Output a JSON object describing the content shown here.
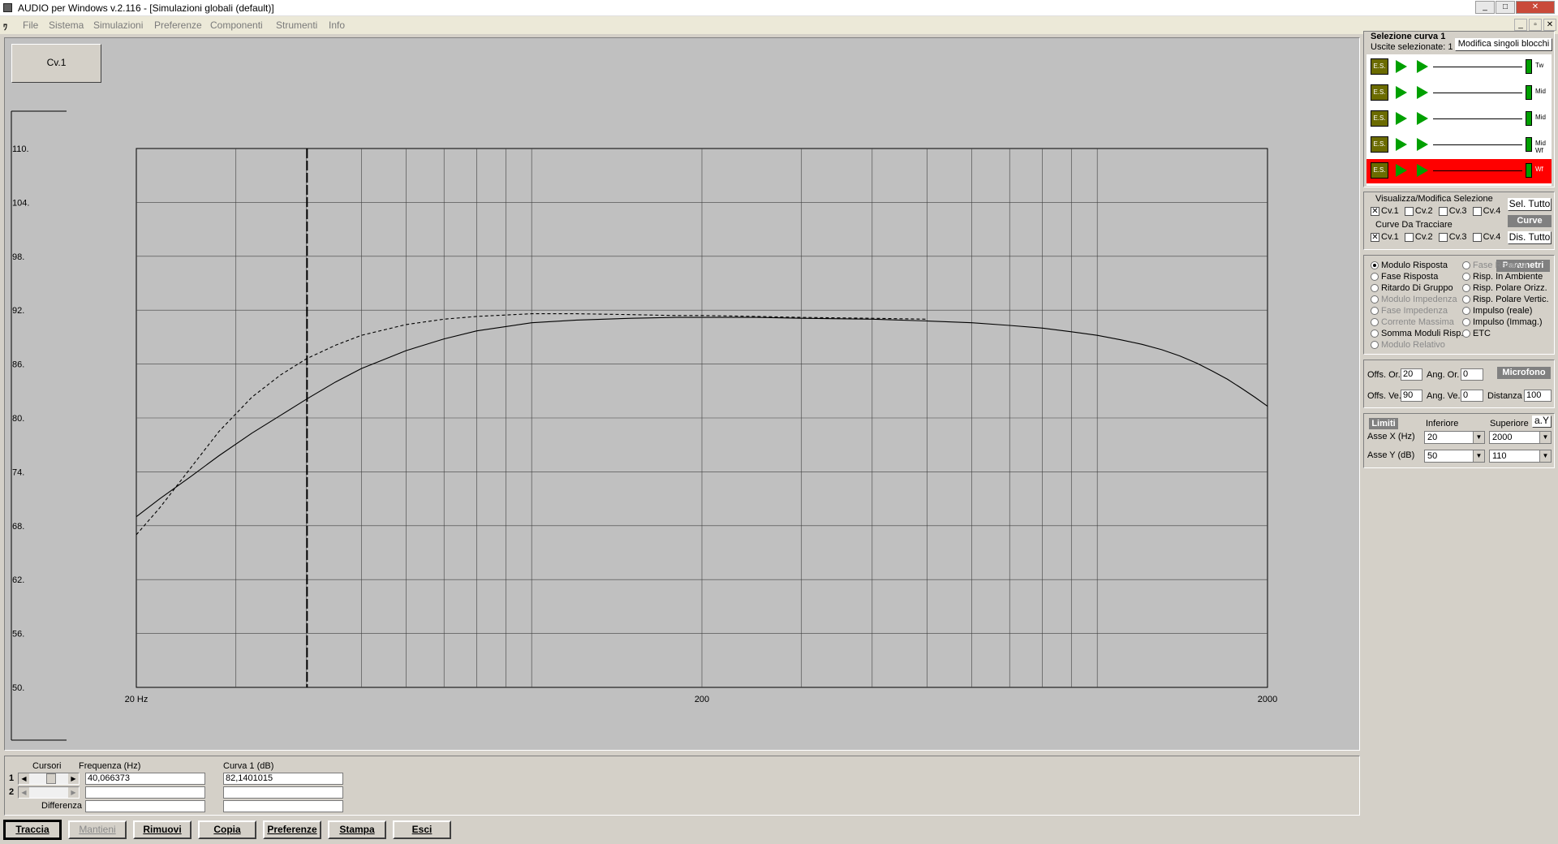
{
  "window": {
    "title": "AUDIO per Windows v.2.116 - [Simulazioni globali (default)]",
    "controls": [
      "_",
      "□",
      "✕"
    ]
  },
  "menu": {
    "items": [
      "File",
      "Sistema",
      "Simulazioni",
      "Preferenze",
      "Componenti",
      "Strumenti",
      "Info"
    ],
    "mdi_controls": [
      "_",
      "▫",
      "✕"
    ]
  },
  "curve_tab": {
    "label": "Cv.1"
  },
  "chart_data": {
    "type": "line",
    "x_scale": "log",
    "xlim": [
      20,
      2000
    ],
    "ylim": [
      50,
      110
    ],
    "y_ticks": [
      "110.",
      "104.",
      "98.",
      "92.",
      "86.",
      "80.",
      "74.",
      "68.",
      "62.",
      "56.",
      "50."
    ],
    "y_tick_values": [
      110,
      104,
      98,
      92,
      86,
      80,
      74,
      68,
      62,
      56,
      50
    ],
    "x_tick_labels": [
      {
        "value": 20,
        "label": "20 Hz"
      },
      {
        "value": 200,
        "label": "200"
      },
      {
        "value": 2000,
        "label": "2000"
      }
    ],
    "grid": true,
    "cursor_x": 40.066373,
    "series": [
      {
        "style": "solid",
        "x": [
          20,
          22,
          25,
          28,
          32,
          36,
          40,
          45,
          50,
          60,
          70,
          80,
          100,
          120,
          150,
          180,
          200,
          250,
          300,
          400,
          500,
          600,
          700,
          800,
          900,
          1000,
          1100,
          1200,
          1300,
          1400,
          1500,
          1600,
          1700,
          1800,
          1900,
          2000
        ],
        "y": [
          69.0,
          71.0,
          73.5,
          75.8,
          78.3,
          80.3,
          82.1,
          84.0,
          85.5,
          87.5,
          88.8,
          89.7,
          90.6,
          90.9,
          91.1,
          91.2,
          91.2,
          91.2,
          91.1,
          91.0,
          90.8,
          90.6,
          90.3,
          90.0,
          89.6,
          89.2,
          88.7,
          88.2,
          87.6,
          86.9,
          86.1,
          85.2,
          84.3,
          83.3,
          82.3,
          81.3
        ]
      },
      {
        "style": "dashed",
        "x": [
          20,
          22,
          25,
          28,
          32,
          36,
          40,
          45,
          50,
          60,
          70,
          80,
          100,
          120,
          150,
          180,
          200,
          250,
          300,
          400,
          500
        ],
        "y": [
          67.0,
          70.0,
          74.5,
          78.5,
          82.3,
          84.8,
          86.6,
          88.1,
          89.2,
          90.4,
          91.0,
          91.3,
          91.6,
          91.6,
          91.5,
          91.4,
          91.4,
          91.3,
          91.2,
          91.1,
          91.0
        ]
      }
    ]
  },
  "cursor_panel": {
    "headers": {
      "cursori": "Cursori",
      "freq": "Frequenza (Hz)",
      "curve": "Curva 1 (dB)"
    },
    "rows": [
      {
        "index": "1",
        "freq": "40,066373",
        "value": "82,1401015"
      },
      {
        "index": "2",
        "freq": "",
        "value": ""
      }
    ],
    "diff_label": "Differenza",
    "diff_value": ""
  },
  "buttons": {
    "traccia": "Traccia",
    "mantieni": "Mantieni",
    "rimuovi": "Rimuovi",
    "copia": "Copia",
    "preferenze": "Preferenze",
    "stampa": "Stampa",
    "esci": "Esci"
  },
  "selection_panel": {
    "title": "Selezione curva 1",
    "subtitle": "Uscite selezionate: 1",
    "button": "Modifica singoli blocchi",
    "block_label": "E.S.",
    "rows": [
      {
        "label": "Tw",
        "selected": false
      },
      {
        "label": "Mid",
        "selected": false
      },
      {
        "label": "Mid",
        "selected": false
      },
      {
        "label": "Mid Wf",
        "selected": false
      },
      {
        "label": "Wf",
        "selected": true
      }
    ],
    "colors": {
      "highlight": "#ff0000",
      "block": "#6b6b00",
      "amp": "#00a000"
    }
  },
  "view_panel": {
    "group1": "Visualizza/Modifica Selezione",
    "group2": "Curve Da Tracciare",
    "curves": [
      "Cv.1",
      "Cv.2",
      "Cv.3",
      "Cv.4"
    ],
    "checked1": [
      true,
      false,
      false,
      false
    ],
    "checked2": [
      true,
      false,
      false,
      false
    ],
    "sel_tutto": "Sel. Tutto",
    "curve_label": "Curve",
    "dis_tutto": "Dis. Tutto"
  },
  "params_panel": {
    "header": "Parametri",
    "left": [
      {
        "label": "Modulo Risposta",
        "enabled": true,
        "selected": true
      },
      {
        "label": "Fase Risposta",
        "enabled": true,
        "selected": false
      },
      {
        "label": "Ritardo Di Gruppo",
        "enabled": true,
        "selected": false
      },
      {
        "label": "Modulo Impedenza",
        "enabled": false,
        "selected": false
      },
      {
        "label": "Fase Impedenza",
        "enabled": false,
        "selected": false
      },
      {
        "label": "Corrente Massima",
        "enabled": false,
        "selected": false
      },
      {
        "label": "Somma Moduli Risp.",
        "enabled": true,
        "selected": false
      },
      {
        "label": "Modulo Relativo",
        "enabled": false,
        "selected": false
      }
    ],
    "right": [
      {
        "label": "Fase Relativa",
        "enabled": false,
        "selected": false
      },
      {
        "label": "Risp. In Ambiente",
        "enabled": true,
        "selected": false
      },
      {
        "label": "Risp. Polare Orizz.",
        "enabled": true,
        "selected": false
      },
      {
        "label": "Risp. Polare Vertic.",
        "enabled": true,
        "selected": false
      },
      {
        "label": "Impulso (reale)",
        "enabled": true,
        "selected": false
      },
      {
        "label": "Impulso (Immag.)",
        "enabled": true,
        "selected": false
      },
      {
        "label": "ETC",
        "enabled": true,
        "selected": false
      }
    ]
  },
  "mic_panel": {
    "header": "Microfono",
    "offs_or_label": "Offs. Or.",
    "offs_or": "20",
    "ang_or_label": "Ang. Or.",
    "ang_or": "0",
    "offs_ve_label": "Offs. Ve.",
    "offs_ve": "90",
    "ang_ve_label": "Ang. Ve.",
    "ang_ve": "0",
    "distanza_label": "Distanza",
    "distanza": "100"
  },
  "limits_panel": {
    "header": "Limiti",
    "inferiore": "Inferiore",
    "superiore": "Superiore",
    "ay": "a.Y",
    "asse_x": "Asse X  (Hz)",
    "asse_y": "Asse Y  (dB)",
    "x_lo": "20",
    "x_hi": "2000",
    "y_lo": "50",
    "y_hi": "110"
  }
}
